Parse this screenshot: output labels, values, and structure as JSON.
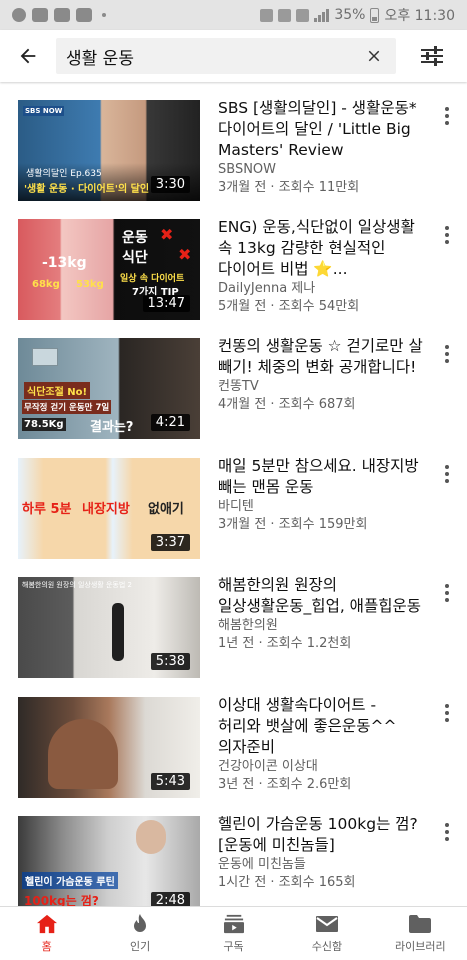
{
  "status_bar": {
    "battery": "35%",
    "time": "오후 11:30"
  },
  "search": {
    "query": "생활 운동"
  },
  "results": [
    {
      "title": "SBS [생활의달인] - 생활운동*다이어트의 달인 / 'Little Big Masters' Review",
      "channel": "SBSNOW",
      "meta": "3개월 전 · 조회수 11만회",
      "duration": "3:30",
      "thumb_texts": [
        "SBS NOW",
        "생활의달인 Ep.635",
        "'생활 운동 · 다이어트'의 달인"
      ]
    },
    {
      "title": "ENG) 운동,식단없이 일상생활 속 13kg 감량한 현실적인 다이어트 비법 ⭐️...",
      "channel": "DailyJenna 제나",
      "meta": "5개월 전 · 조회수 54만회",
      "duration": "13:47",
      "thumb_texts": [
        "-13kg",
        "68kg",
        "53kg",
        "운동",
        "식단",
        "일상 속 다이어트",
        "7가지 TIP"
      ]
    },
    {
      "title": "컨똥의 생활운동 ☆ 걷기로만 살 빼기! 체중의 변화 공개합니다!",
      "channel": "컨똥TV",
      "meta": "4개월 전 · 조회수 687회",
      "duration": "4:21",
      "thumb_texts": [
        "식단조절 No!",
        "무작정 걷기 운동만 7일",
        "78.5Kg",
        "결과는?"
      ]
    },
    {
      "title": "매일 5분만 참으세요. 내장지방 빼는 맨몸 운동",
      "channel": "바디텐",
      "meta": "3개월 전 · 조회수 159만회",
      "duration": "3:37",
      "thumb_texts": [
        "하루 5분",
        "내장지방",
        "없애기"
      ]
    },
    {
      "title": "해봄한의원 원장의 일상생활운동_힙업, 애플힙운동",
      "channel": "해봄한의원",
      "meta": "1년 전 · 조회수 1.2천회",
      "duration": "5:38",
      "thumb_texts": [
        "해봄한의원 원장의 일상생활 운동법 2"
      ]
    },
    {
      "title": "이상대 생활속다이어트 - 허리와 뱃살에 좋은운동^^ 의자준비",
      "channel": "건강아이콘 이상대",
      "meta": "3년 전 · 조회수 2.6만회",
      "duration": "5:43",
      "thumb_texts": []
    },
    {
      "title": "헬린이 가슴운동 100kg는 껌? [운동에 미친놈들]",
      "channel": "운동에 미친놈들",
      "meta": "1시간 전 · 조회수 165회",
      "duration": "2:48",
      "thumb_texts": [
        "헬린이 가슴운동 루틴",
        "100kg는 껌?"
      ]
    }
  ],
  "bottom_nav": [
    {
      "label": "홈",
      "icon": "home-icon",
      "active": true
    },
    {
      "label": "인기",
      "icon": "flame-icon",
      "active": false
    },
    {
      "label": "구독",
      "icon": "subscriptions-icon",
      "active": false
    },
    {
      "label": "수신함",
      "icon": "mail-icon",
      "active": false
    },
    {
      "label": "라이브러리",
      "icon": "folder-icon",
      "active": false
    }
  ],
  "colors": {
    "accent": "#e62117",
    "text_primary": "#0f0f0f",
    "text_secondary": "#606060"
  }
}
